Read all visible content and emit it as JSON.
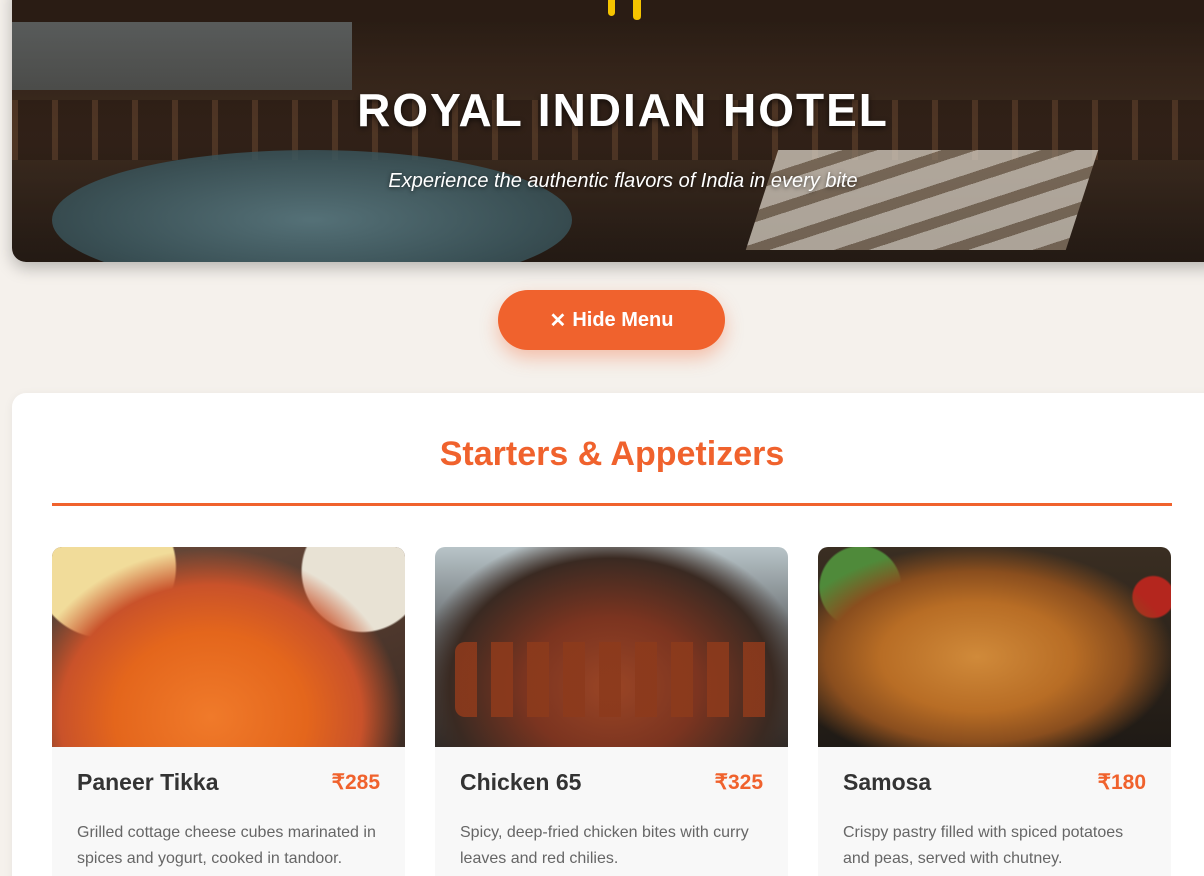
{
  "hero": {
    "title": "ROYAL INDIAN HOTEL",
    "subtitle": "Experience the authentic flavors of India in every bite",
    "icon": "fork-knife-icon"
  },
  "toggle": {
    "icon": "✕",
    "label": "Hide Menu"
  },
  "section": {
    "title": "Starters & Appetizers"
  },
  "items": [
    {
      "name": "Paneer Tikka",
      "price": "₹285",
      "description": "Grilled cottage cheese cubes marinated in spices and yogurt, cooked in tandoor."
    },
    {
      "name": "Chicken 65",
      "price": "₹325",
      "description": "Spicy, deep-fried chicken bites with curry leaves and red chilies."
    },
    {
      "name": "Samosa",
      "price": "₹180",
      "description": "Crispy pastry filled with spiced potatoes and peas, served with chutney."
    }
  ],
  "colors": {
    "accent": "#f0622d",
    "icon": "#f5c400",
    "background": "#f5f1ec"
  }
}
